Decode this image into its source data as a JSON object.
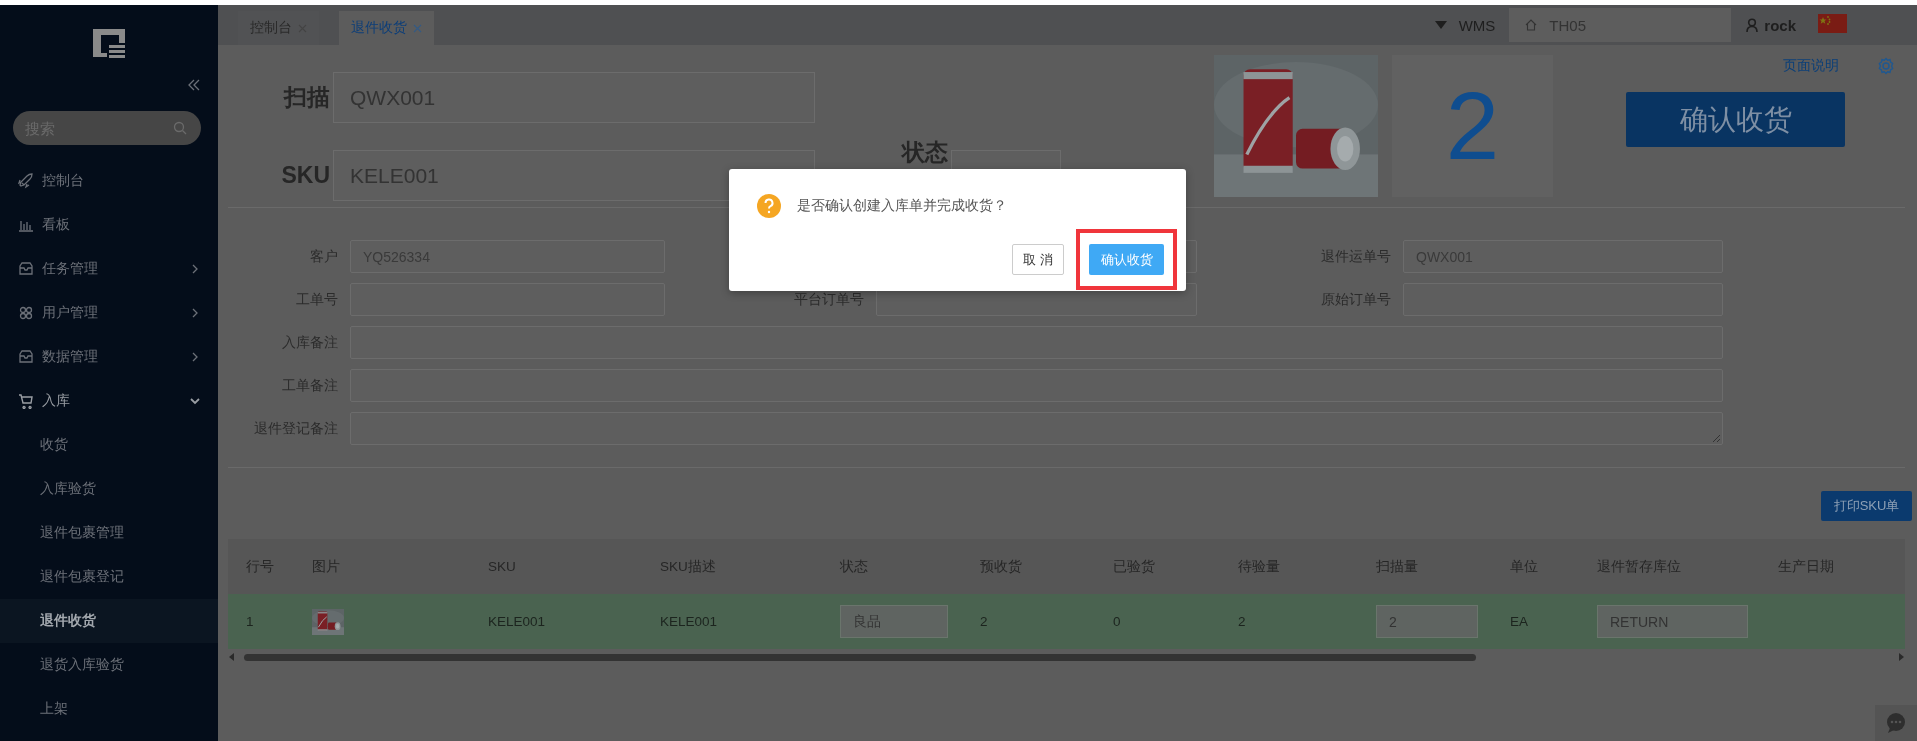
{
  "sidebar": {
    "search": {
      "placeholder": "搜索"
    },
    "items": [
      {
        "label": "控制台"
      },
      {
        "label": "看板"
      },
      {
        "label": "任务管理",
        "expanded": false
      },
      {
        "label": "用户管理",
        "expanded": false
      },
      {
        "label": "数据管理",
        "expanded": false
      },
      {
        "label": "入库",
        "expanded": true,
        "children": [
          {
            "label": "收货",
            "selected": false
          },
          {
            "label": "入库验货",
            "selected": false
          },
          {
            "label": "退件包裹管理",
            "selected": false
          },
          {
            "label": "退件包裹登记",
            "selected": false
          },
          {
            "label": "退件收货",
            "selected": true
          },
          {
            "label": "退货入库验货",
            "selected": false
          },
          {
            "label": "上架",
            "selected": false
          }
        ]
      }
    ]
  },
  "tabs": [
    {
      "label": "控制台",
      "selected": false
    },
    {
      "label": "退件收货",
      "selected": true
    }
  ],
  "header": {
    "system": "WMS",
    "warehouse": "TH05",
    "user": "rock"
  },
  "scan": {
    "label": "扫描",
    "value": "QWX001"
  },
  "sku": {
    "label": "SKU",
    "value": "KELE001"
  },
  "status": {
    "label": "状态"
  },
  "count": "2",
  "confirm_button": "确认收货",
  "help_link": "页面说明",
  "form": {
    "fields": [
      {
        "kind": "short",
        "label": "客户",
        "value": "YQ526334"
      },
      {
        "kind": "short"
      },
      {
        "kind": "short",
        "label": "退件运单号",
        "value": "QWX001"
      },
      {
        "kind": "short",
        "label": "工单号"
      },
      {
        "kind": "short",
        "label": "平台订单号"
      },
      {
        "kind": "short",
        "label": "原始订单号"
      },
      {
        "kind": "wide",
        "label": "入库备注"
      },
      {
        "kind": "wide",
        "label": "工单备注"
      },
      {
        "kind": "textarea",
        "label": "退件登记备注"
      }
    ]
  },
  "print_button": "打印SKU单",
  "table": {
    "columns": [
      "行号",
      "图片",
      "SKU",
      "SKU描述",
      "状态",
      "预收货",
      "已验货",
      "待验量",
      "扫描量",
      "单位",
      "退件暂存库位",
      "生产日期"
    ],
    "rows": [
      {
        "selected": true,
        "cells": [
          {
            "kind": "text",
            "text": "1"
          },
          {
            "kind": "picture"
          },
          {
            "kind": "text",
            "text": "KELE001"
          },
          {
            "kind": "text",
            "text": "KELE001"
          },
          {
            "kind": "select",
            "value": "良品"
          },
          {
            "kind": "text",
            "text": "2"
          },
          {
            "kind": "text",
            "text": "0"
          },
          {
            "kind": "text",
            "text": "2"
          },
          {
            "kind": "input",
            "value": "2"
          },
          {
            "kind": "text",
            "text": "EA"
          },
          {
            "kind": "input",
            "value": "RETURN"
          }
        ]
      }
    ]
  },
  "dialog": {
    "message": "是否确认创建入库单并完成收货？",
    "buttons": [
      {
        "kind": "default",
        "label": "取 消",
        "highlighted": false
      },
      {
        "kind": "primary",
        "label": "确认收货",
        "highlighted": true
      }
    ]
  }
}
